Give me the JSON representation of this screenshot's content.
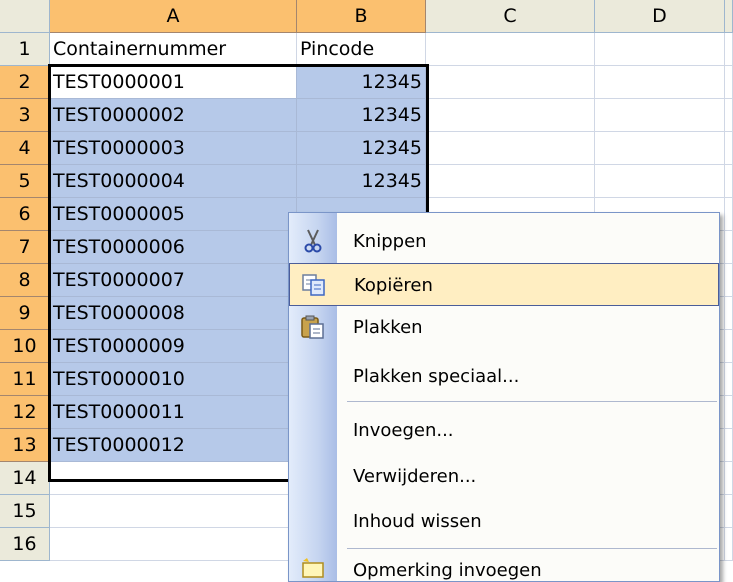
{
  "columns": [
    "A",
    "B",
    "C",
    "D"
  ],
  "headers_row": {
    "a": "Containernummer",
    "b": "Pincode"
  },
  "rows": [
    {
      "n": "1",
      "a": "Containernummer",
      "b": "Pincode"
    },
    {
      "n": "2",
      "a": "TEST0000001",
      "b": "12345"
    },
    {
      "n": "3",
      "a": "TEST0000002",
      "b": "12345"
    },
    {
      "n": "4",
      "a": "TEST0000003",
      "b": "12345"
    },
    {
      "n": "5",
      "a": "TEST0000004",
      "b": "12345"
    },
    {
      "n": "6",
      "a": "TEST0000005",
      "b": ""
    },
    {
      "n": "7",
      "a": "TEST0000006",
      "b": ""
    },
    {
      "n": "8",
      "a": "TEST0000007",
      "b": ""
    },
    {
      "n": "9",
      "a": "TEST0000008",
      "b": ""
    },
    {
      "n": "10",
      "a": "TEST0000009",
      "b": ""
    },
    {
      "n": "11",
      "a": "TEST0000010",
      "b": ""
    },
    {
      "n": "12",
      "a": "TEST0000011",
      "b": ""
    },
    {
      "n": "13",
      "a": "TEST0000012",
      "b": ""
    },
    {
      "n": "14",
      "a": "",
      "b": ""
    },
    {
      "n": "15",
      "a": "",
      "b": ""
    },
    {
      "n": "16",
      "a": "",
      "b": ""
    }
  ],
  "context_menu": {
    "items": [
      {
        "label": "Knippen",
        "icon": "scissors-icon"
      },
      {
        "label": "Kopiëren",
        "icon": "copy-icon",
        "highlighted": true
      },
      {
        "label": "Plakken",
        "icon": "paste-icon"
      },
      {
        "label": "Plakken speciaal..."
      },
      {
        "label": "Invoegen..."
      },
      {
        "label": "Verwijderen..."
      },
      {
        "label": "Inhoud wissen"
      },
      {
        "label": "Opmerking invoegen",
        "icon": "comment-icon"
      }
    ]
  },
  "colors": {
    "selection": "#b6c9e9",
    "header_bg": "#ebeadb",
    "header_selected": "#fbc06f",
    "menu_hover": "#ffeec2"
  }
}
